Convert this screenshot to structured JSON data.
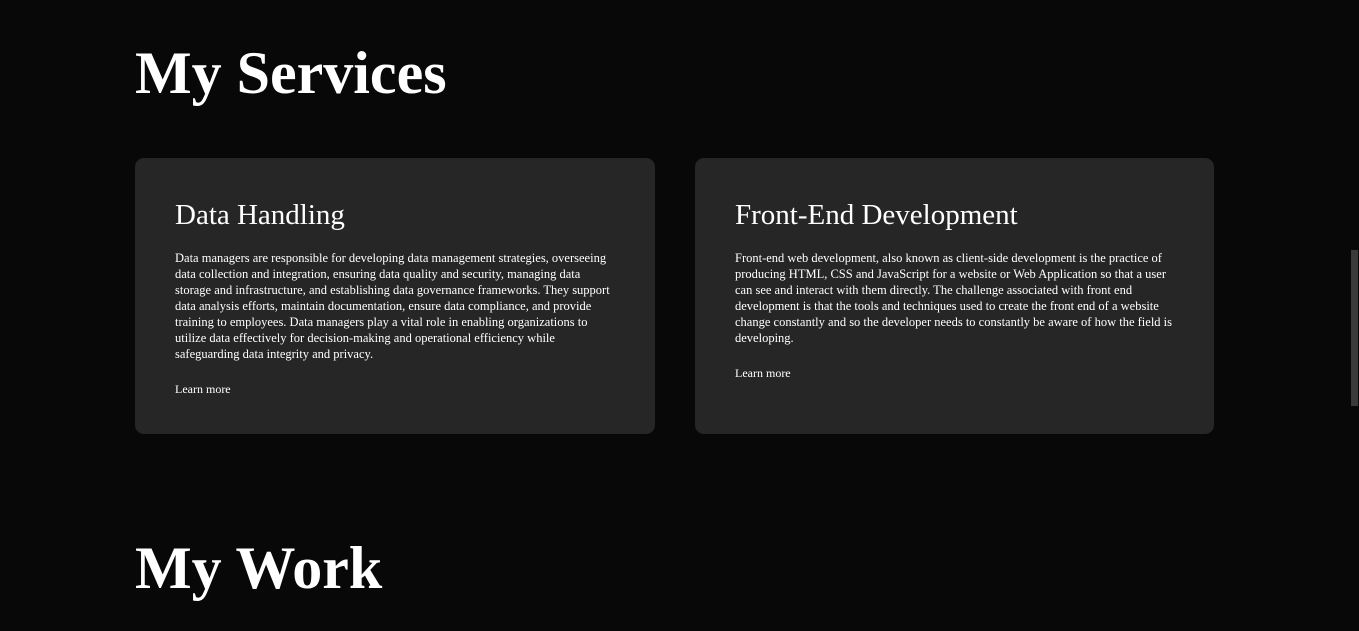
{
  "services": {
    "title": "My Services",
    "cards": [
      {
        "title": "Data Handling",
        "text": "Data managers are responsible for developing data management strategies, overseeing data collection and integration, ensuring data quality and security, managing data storage and infrastructure, and establishing data governance frameworks. They support data analysis efforts, maintain documentation, ensure data compliance, and provide training to employees. Data managers play a vital role in enabling organizations to utilize data effectively for decision-making and operational efficiency while safeguarding data integrity and privacy.",
        "link": "Learn more"
      },
      {
        "title": "Front-End Development",
        "text": "Front-end web development, also known as client-side development is the practice of producing HTML, CSS and JavaScript for a website or Web Application so that a user can see and interact with them directly. The challenge associated with front end development is that the tools and techniques used to create the front end of a website change constantly and so the developer needs to constantly be aware of how the field is developing.",
        "link": "Learn more"
      }
    ]
  },
  "work": {
    "title": "My Work"
  },
  "colors": {
    "background": "#080808",
    "card_background": "#262626",
    "text": "#ffffff"
  }
}
